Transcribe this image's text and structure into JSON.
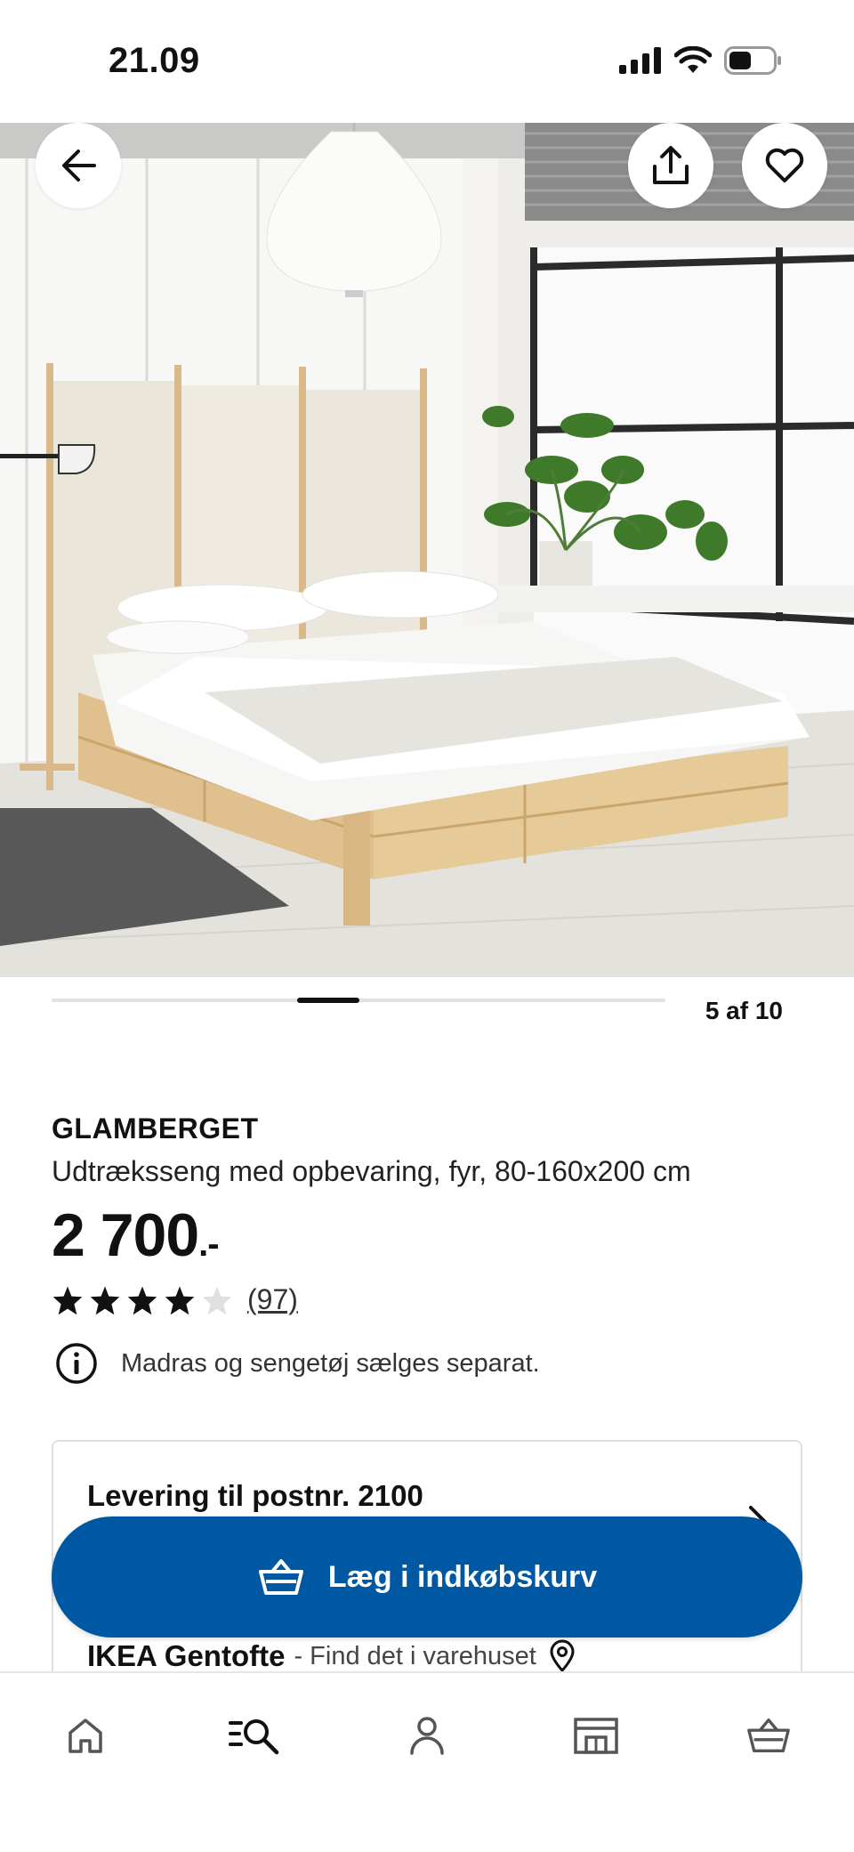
{
  "status_bar": {
    "time": "21.09",
    "icons": [
      "cellular-signal-icon",
      "wifi-icon",
      "battery-icon"
    ]
  },
  "hero": {
    "image": "glamberget-bed-bedroom-photo",
    "buttons": [
      "back-arrow-icon",
      "share-icon",
      "heart-icon"
    ]
  },
  "carousel": {
    "current": "5",
    "total": "10",
    "counter_text": "5 af 10"
  },
  "product": {
    "name": "GLAMBERGET",
    "description": "Udtræksseng med opbevaring, fyr, 80-160x200 cm",
    "price": "2 700",
    "price_suffix": ".-",
    "rating_value": 4,
    "rating_max": 5,
    "review_count": "(97)",
    "info_note": "Madras og sengetøj sælges separat."
  },
  "delivery": {
    "title": "Levering til postnr. 2100",
    "store_name": "IKEA Gentofte",
    "store_sub": "- Find det i varehuset"
  },
  "cta": {
    "label": "Læg i indkøbskurv"
  },
  "bottom_nav": {
    "items": [
      "home-icon",
      "search-list-icon",
      "account-icon",
      "store-icon",
      "basket-icon"
    ]
  },
  "colors": {
    "accent": "#0058a3",
    "text": "#111111",
    "star_filled": "#111111",
    "star_empty": "#e0e0e0"
  }
}
